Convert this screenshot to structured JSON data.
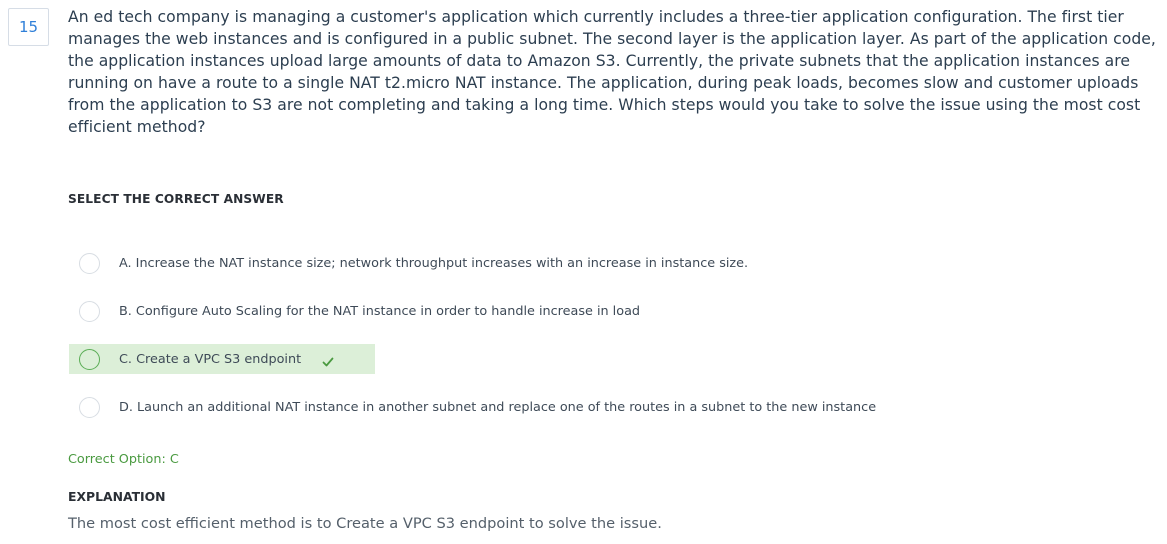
{
  "question": {
    "number": "15",
    "text": "An ed tech company is managing a customer's application which currently includes a three-tier application configuration. The first tier manages the web instances and is configured in a public subnet. The second layer is the application layer. As part of the application code, the application instances upload large amounts of data to Amazon S3. Currently, the private subnets that the application instances are running on have a route to a single NAT t2.micro NAT instance. The application, during peak loads, becomes slow and customer uploads from the application to S3 are not completing and taking a long time. Which steps would you take to solve the issue using the most cost efficient method?"
  },
  "answers": {
    "heading": "SELECT THE CORRECT ANSWER",
    "options": [
      {
        "label": "A. Increase the NAT instance size; network throughput increases with an increase in instance size.",
        "correct": false
      },
      {
        "label": "B. Configure Auto Scaling for the NAT instance in order to handle increase in load",
        "correct": false
      },
      {
        "label": "C. Create a VPC S3 endpoint",
        "correct": true
      },
      {
        "label": "D. Launch an additional NAT instance in another subnet and replace one of the routes in a subnet to the new instance",
        "correct": false
      }
    ]
  },
  "result": {
    "correct_option": "Correct Option: C"
  },
  "explanation": {
    "heading": "EXPLANATION",
    "text": "The most cost efficient method is to Create a VPC S3 endpoint to solve the issue."
  },
  "colors": {
    "accent_blue": "#2f7fd8",
    "correct_green": "#4a9a40",
    "correct_bg": "#dcefd8"
  },
  "icons": {
    "correct_marker": "check-icon"
  }
}
